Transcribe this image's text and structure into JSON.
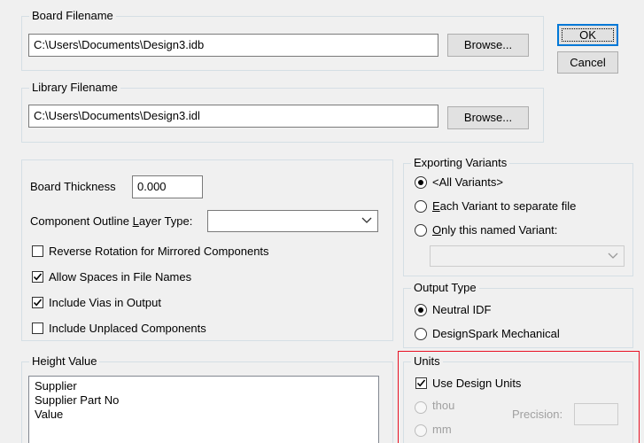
{
  "board_filename": {
    "legend": "Board Filename",
    "value": "C:\\Users\\Documents\\Design3.idb",
    "browse_label": "Browse..."
  },
  "library_filename": {
    "legend": "Library Filename",
    "value": "C:\\Users\\Documents\\Design3.idl",
    "browse_label": "Browse..."
  },
  "dialog_buttons": {
    "ok_label": "OK",
    "cancel_label": "Cancel"
  },
  "options": {
    "board_thickness_label": "Board Thickness",
    "board_thickness_value": "0.000",
    "layer_type_label_pre": "Component Outline ",
    "layer_type_label_key": "L",
    "layer_type_label_post": "ayer Type:",
    "layer_type_value": "",
    "checkboxes": [
      {
        "label": "Reverse Rotation for Mirrored Components",
        "checked": false
      },
      {
        "label": "Allow Spaces in File Names",
        "checked": true
      },
      {
        "label": "Include Vias in Output",
        "checked": true
      },
      {
        "label": "Include Unplaced Components",
        "checked": false
      }
    ]
  },
  "exporting_variants": {
    "legend": "Exporting Variants",
    "options": [
      {
        "label": "<All Variants>",
        "checked": true
      },
      {
        "label_pre": "",
        "label_key": "E",
        "label_post": "ach Variant to separate file",
        "checked": false
      },
      {
        "label_pre": "",
        "label_key": "O",
        "label_post": "nly this named Variant:",
        "checked": false
      }
    ],
    "named_variant_value": ""
  },
  "output_type": {
    "legend": "Output Type",
    "options": [
      {
        "label": "Neutral IDF",
        "checked": true
      },
      {
        "label": "DesignSpark Mechanical",
        "checked": false
      }
    ]
  },
  "height_value": {
    "legend": "Height Value",
    "items": [
      "Supplier",
      "Supplier Part No",
      "Value"
    ]
  },
  "units": {
    "legend": "Units",
    "use_design_units_label": "Use Design Units",
    "use_design_units_checked": true,
    "thou_label": "thou",
    "mm_label": "mm",
    "precision_label": "Precision:",
    "precision_value": ""
  },
  "colors": {
    "highlight": "#e81123",
    "default_button_border": "#0078d7"
  }
}
